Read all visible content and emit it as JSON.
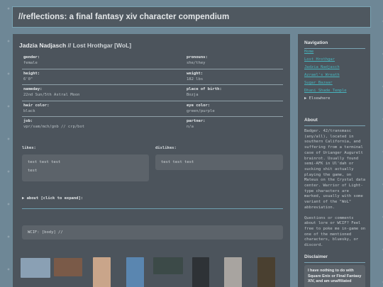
{
  "site": {
    "title": "//reflections: a final fantasy xiv character compendium"
  },
  "character": {
    "name": "Jadzia Nadjasch",
    "separator": "//",
    "world": "Lost Hrothgar [WoL]",
    "fields": [
      {
        "label": "gender:",
        "value": "female"
      },
      {
        "label": "pronouns:",
        "value": "she/they"
      },
      {
        "label": "height:",
        "value": "6'0\""
      },
      {
        "label": "weight:",
        "value": "182 lbs"
      },
      {
        "label": "nameday:",
        "value": "22nd Sun/5th Astral Moon"
      },
      {
        "label": "place of birth:",
        "value": "Bozja"
      },
      {
        "label": "hair color:",
        "value": "black"
      },
      {
        "label": "eye color:",
        "value": "green/purple"
      },
      {
        "label": "job:",
        "value": "vpr/sam/mch/gnb // crp/bot"
      },
      {
        "label": "partner:",
        "value": "n/a"
      }
    ],
    "likes_label": "likes:",
    "likes": [
      "test test test",
      "test"
    ],
    "dislikes_label": "dislikes:",
    "dislikes": [
      "test test test"
    ],
    "about_toggle": "▶ about [click to expand]:",
    "wcif": "WCIF: [body] //"
  },
  "gallery": {
    "thumbs": [
      {
        "color": "#8aa0b4"
      },
      {
        "color": "#7a5a48"
      },
      {
        "color": "#c9a58a"
      },
      {
        "color": "#5a86b0"
      },
      {
        "color": "#3c4a48"
      },
      {
        "color": "#2e3236"
      },
      {
        "color": "#a8a4a0"
      },
      {
        "color": "#4a4030"
      }
    ]
  },
  "sidebar": {
    "nav_title": "Navigation",
    "nav": [
      {
        "label": "Home"
      },
      {
        "label": "Lost Hrothgar"
      },
      {
        "label": "Jadzia Nadjasch"
      },
      {
        "label": "Azrael's Wreath"
      },
      {
        "label": "Sugar Bazaar"
      },
      {
        "label": "Dhani Shade Temple"
      }
    ],
    "nav_more": "▶ Elsewhere",
    "about_title": "About",
    "about_text": "Badger. 42/transmasc (any/all), located in southern California, and suffering from a terminal case of Urianger Augurelt brainrot. Usually found semi-AFK in Ul'dah or sucking shit actually playing the game, on Mateus on the Crystal data center. Warrior of Light-type characters are marked, usually with some variant of the \"WoL\" abbreviation.",
    "about_text2": "Questions or comments about lore or WCIF? Feel free to poke me in-game on one of the mentioned characters, bluesky, or discord.",
    "disclaimer_title": "Disclaimer",
    "disclaimer_text": "I have nothing to do with Square Enix or Final Fantasy XIV, and am unaffiliated"
  }
}
